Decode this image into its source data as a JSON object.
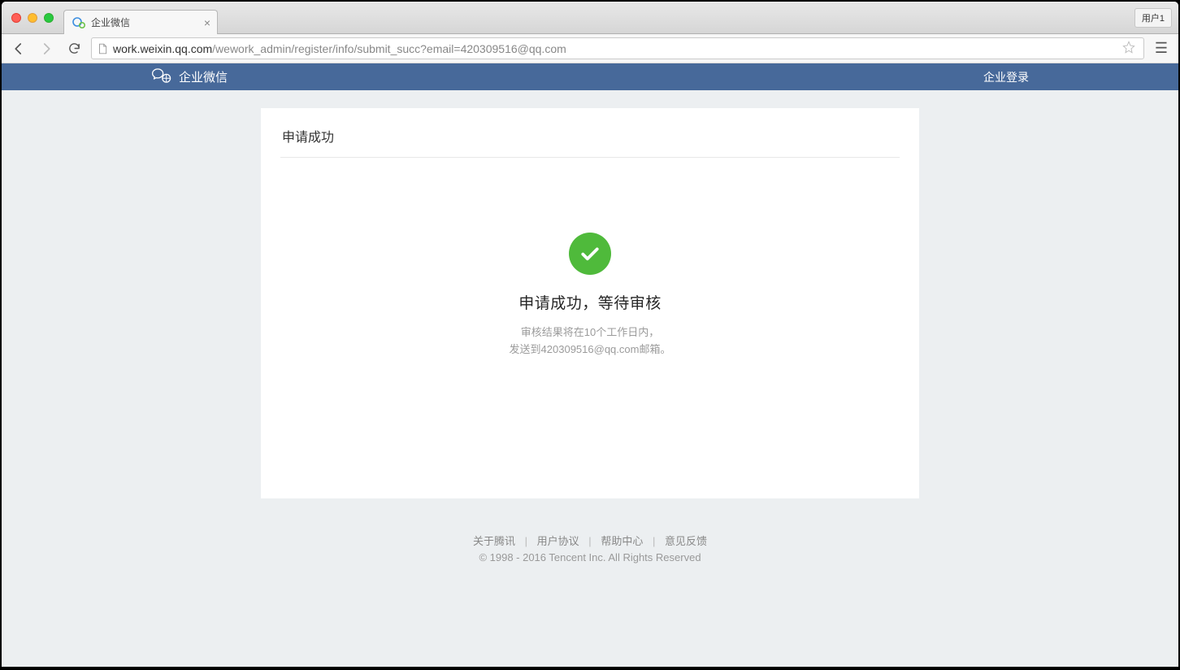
{
  "browser": {
    "tab_title": "企业微信",
    "user_label": "用户1",
    "url_host": "work.weixin.qq.com",
    "url_path": "/wework_admin/register/info/submit_succ?email=420309516@qq.com"
  },
  "nav": {
    "brand": "企业微信",
    "login": "企业登录"
  },
  "card": {
    "title": "申请成功",
    "success_heading": "申请成功，等待审核",
    "desc_line1": "审核结果将在10个工作日内，",
    "desc_line2": "发送到420309516@qq.com邮箱。"
  },
  "footer": {
    "links": {
      "about": "关于腾讯",
      "agreement": "用户协议",
      "help": "帮助中心",
      "feedback": "意见反馈"
    },
    "copyright": "© 1998 - 2016 Tencent Inc. All Rights Reserved"
  }
}
